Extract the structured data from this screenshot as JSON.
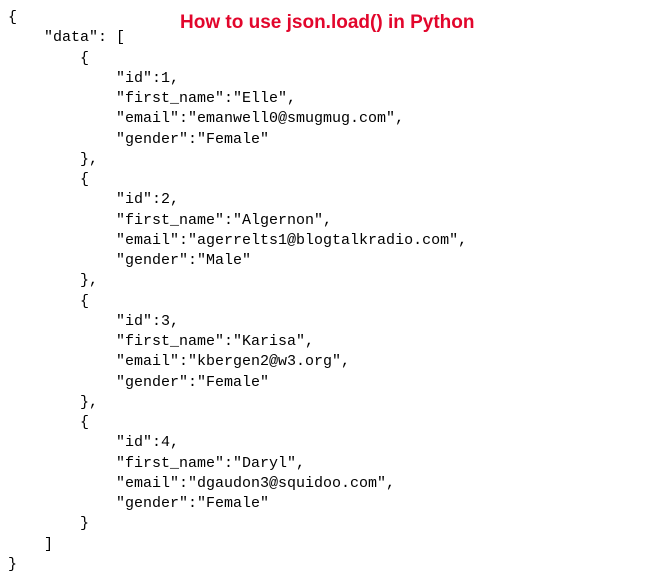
{
  "title": "How to use json.load() in Python",
  "code": "{\n    \"data\": [\n        {\n            \"id\":1,\n            \"first_name\":\"Elle\",\n            \"email\":\"emanwell0@smugmug.com\",\n            \"gender\":\"Female\"\n        },\n        {\n            \"id\":2,\n            \"first_name\":\"Algernon\",\n            \"email\":\"agerrelts1@blogtalkradio.com\",\n            \"gender\":\"Male\"\n        },\n        {\n            \"id\":3,\n            \"first_name\":\"Karisa\",\n            \"email\":\"kbergen2@w3.org\",\n            \"gender\":\"Female\"\n        },\n        {\n            \"id\":4,\n            \"first_name\":\"Daryl\",\n            \"email\":\"dgaudon3@squidoo.com\",\n            \"gender\":\"Female\"\n        }\n    ]\n}"
}
